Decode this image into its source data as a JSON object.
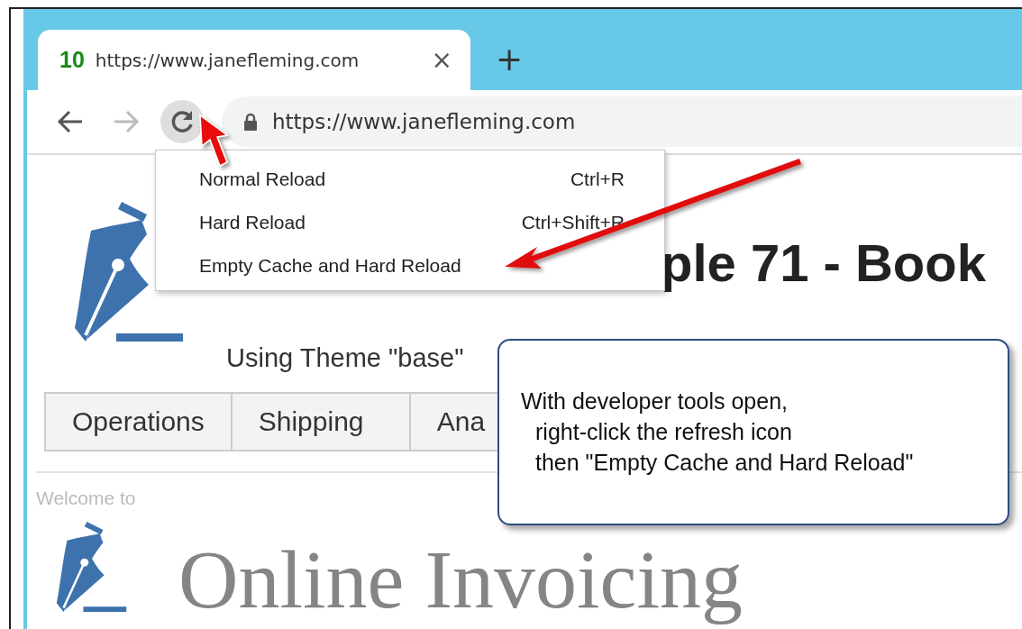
{
  "browser": {
    "tab": {
      "badge": "10",
      "title": "https://www.janefleming.com",
      "close": "×"
    },
    "new_tab": "+",
    "address": "https://www.janefleming.com"
  },
  "context_menu": [
    {
      "label": "Normal Reload",
      "shortcut": "Ctrl+R"
    },
    {
      "label": "Hard Reload",
      "shortcut": "Ctrl+Shift+R"
    },
    {
      "label": "Empty Cache and Hard Reload"
    }
  ],
  "page": {
    "title": "ple 71 - Book",
    "subtitle": "Using Theme \"base\"",
    "nav_tabs": [
      {
        "label": "Operations"
      },
      {
        "label": "Shipping"
      },
      {
        "label": "Ana"
      }
    ],
    "welcome": "Welcome to",
    "app_name": "Online Invoicing"
  },
  "callout": {
    "lines": [
      {
        "text": "With developer tools open,",
        "indent": false
      },
      {
        "text": "right-click the refresh icon",
        "indent": true
      },
      {
        "text": "then \"Empty Cache and Hard Reload\"",
        "indent": true
      }
    ]
  }
}
